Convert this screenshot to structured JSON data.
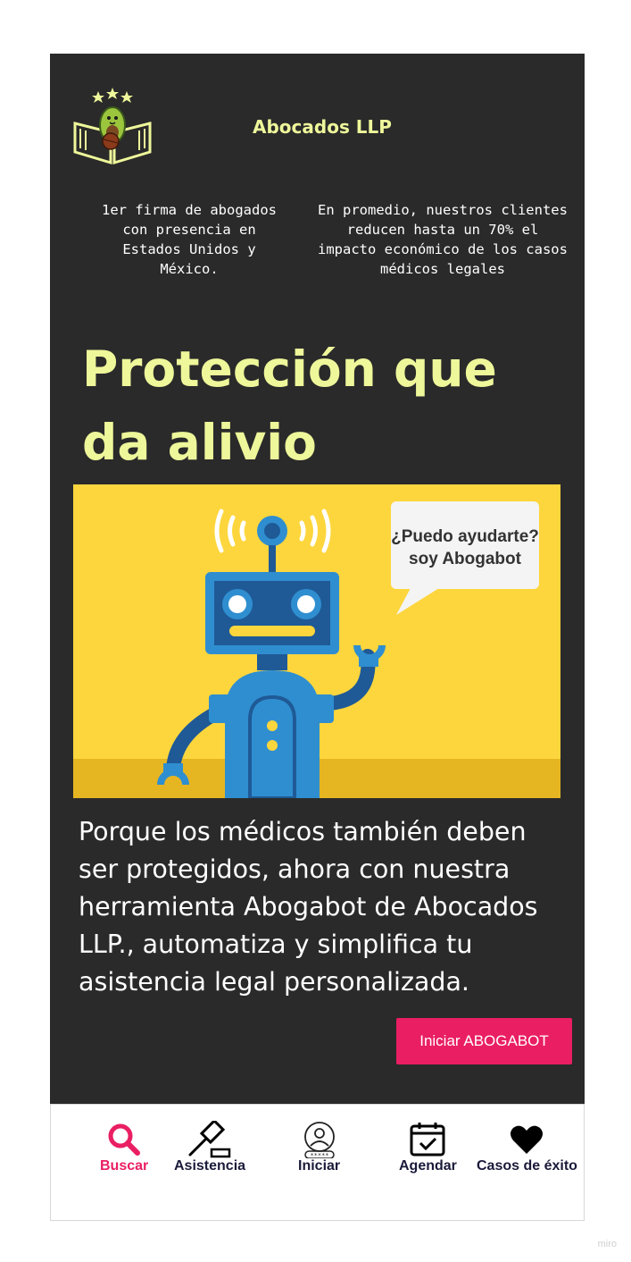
{
  "header": {
    "brand": "Abocados LLP",
    "logo_icon": "avocado-book-logo-icon"
  },
  "stats": {
    "left": "1er firma de abogados con presencia en Estados Unidos y México.",
    "right": "En promedio, nuestros clientes reducen hasta un 70% el impacto económico de los casos médicos legales"
  },
  "hero": {
    "title": "Protección que da alivio",
    "bubble_line1": "¿Puedo ayudarte?",
    "bubble_line2": "soy Abogabot",
    "image_icon": "robot-illustration"
  },
  "description": "Porque los médicos también deben ser protegidos, ahora con nuestra herramienta Abogabot de Abocados LLP., automatiza y simplifica tu asistencia legal personalizada.",
  "cta": {
    "label": "Iniciar ABOGABOT"
  },
  "nav": {
    "search": {
      "label": "Buscar",
      "icon": "search-icon"
    },
    "assist": {
      "label": "Asistencia",
      "icon": "gavel-icon"
    },
    "login": {
      "label": "Iniciar",
      "icon": "user-login-icon"
    },
    "schedule": {
      "label": "Agendar",
      "icon": "calendar-check-icon"
    },
    "cases": {
      "label": "Casos de éxito",
      "icon": "heart-icon"
    }
  },
  "watermark": "miro",
  "colors": {
    "background": "#2a2a2a",
    "accent_yellow": "#eef79a",
    "accent_pink": "#e91e63",
    "hero_bg": "#fdd63d",
    "robot_blue": "#2f8ed0"
  }
}
